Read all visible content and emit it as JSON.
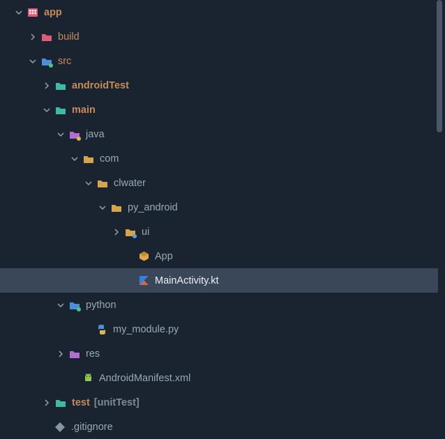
{
  "tree": {
    "app": {
      "label": "app",
      "chev": "down",
      "indent": 20,
      "icon": "app",
      "bold": true,
      "accent": true
    },
    "build": {
      "label": "build",
      "chev": "right",
      "indent": 40,
      "icon": "folder-pink",
      "accent": true
    },
    "src": {
      "label": "src",
      "chev": "down",
      "indent": 40,
      "icon": "folder-blue",
      "accent": true
    },
    "androidTest": {
      "label": "androidTest",
      "chev": "right",
      "indent": 60,
      "icon": "folder-teal",
      "bold": true,
      "accent": true
    },
    "main": {
      "label": "main",
      "chev": "down",
      "indent": 60,
      "icon": "folder-teal",
      "bold": true,
      "accent": true
    },
    "java": {
      "label": "java",
      "chev": "down",
      "indent": 80,
      "icon": "folder-purple-java"
    },
    "com": {
      "label": "com",
      "chev": "down",
      "indent": 100,
      "icon": "folder"
    },
    "clwater": {
      "label": "clwater",
      "chev": "down",
      "indent": 120,
      "icon": "folder"
    },
    "py_android": {
      "label": "py_android",
      "chev": "down",
      "indent": 140,
      "icon": "folder"
    },
    "ui": {
      "label": "ui",
      "chev": "right",
      "indent": 160,
      "icon": "folder-badge"
    },
    "App": {
      "label": "App",
      "chev": "",
      "indent": 179,
      "icon": "box"
    },
    "MainActivity": {
      "label": "MainActivity.kt",
      "chev": "",
      "indent": 179,
      "icon": "kotlin",
      "selected": true
    },
    "python": {
      "label": "python",
      "chev": "down",
      "indent": 80,
      "icon": "folder-blue-badge"
    },
    "my_module": {
      "label": "my_module.py",
      "chev": "",
      "indent": 119,
      "icon": "python"
    },
    "res": {
      "label": "res",
      "chev": "right",
      "indent": 80,
      "icon": "folder-purple-res"
    },
    "AndroidManifest": {
      "label": "AndroidManifest.xml",
      "chev": "",
      "indent": 99,
      "icon": "android"
    },
    "test": {
      "label": "test",
      "chev": "right",
      "indent": 60,
      "icon": "folder-teal",
      "bold": true,
      "accent": true,
      "qual": "[unitTest]"
    },
    "gitignore": {
      "label": ".gitignore",
      "chev": "",
      "indent": 59,
      "icon": "git"
    }
  },
  "order": [
    "app",
    "build",
    "src",
    "androidTest",
    "main",
    "java",
    "com",
    "clwater",
    "py_android",
    "ui",
    "App",
    "MainActivity",
    "python",
    "my_module",
    "res",
    "AndroidManifest",
    "test",
    "gitignore"
  ]
}
